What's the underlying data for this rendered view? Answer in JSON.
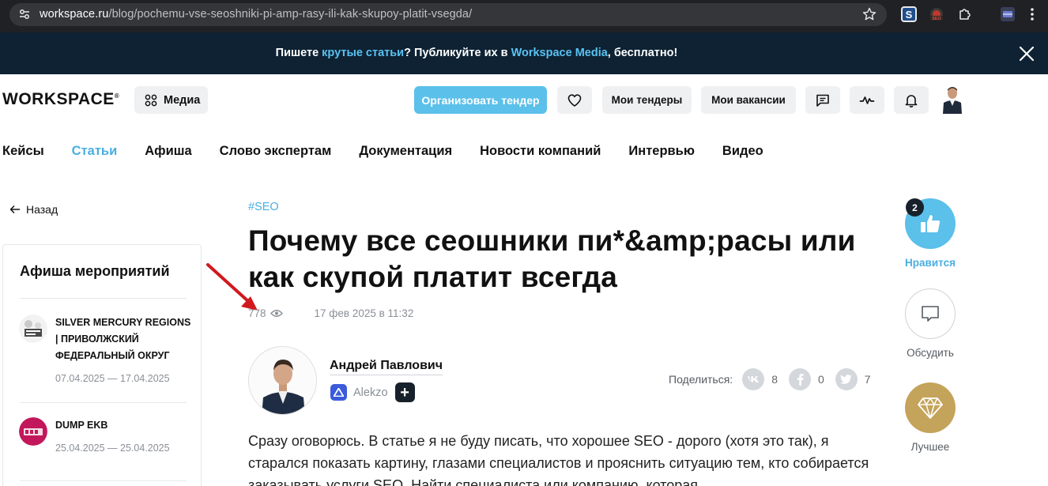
{
  "browser": {
    "url_host": "workspace.ru",
    "url_path": "/blog/pochemu-vse-seoshniki-pi-amp-rasy-ili-kak-skupoy-platit-vsegda/"
  },
  "promo": {
    "part1": "Пишете ",
    "link1": "крутые статьи",
    "part2": "? Публикуйте их в ",
    "link2": "Workspace Media",
    "part3": ", бесплатно!"
  },
  "header": {
    "logo": "WORKSPACE",
    "media_label": "Медиа",
    "tender_label": "Организовать тендер",
    "my_tenders": "Мои тендеры",
    "my_vacancies": "Мои вакансии"
  },
  "nav": [
    {
      "label": "Кейсы",
      "active": false
    },
    {
      "label": "Статьи",
      "active": true
    },
    {
      "label": "Афиша",
      "active": false
    },
    {
      "label": "Слово экспертам",
      "active": false
    },
    {
      "label": "Документация",
      "active": false
    },
    {
      "label": "Новости компаний",
      "active": false
    },
    {
      "label": "Интервью",
      "active": false
    },
    {
      "label": "Видео",
      "active": false
    }
  ],
  "back_label": "Назад",
  "events": {
    "title": "Афиша мероприятий",
    "items": [
      {
        "name": "SILVER MERCURY REGIONS | ПРИВОЛЖСКИЙ ФЕДЕРАЛЬНЫЙ ОКРУГ",
        "dates": "07.04.2025 — 17.04.2025"
      },
      {
        "name": "DUMP EKB",
        "dates": "25.04.2025 — 25.04.2025"
      }
    ]
  },
  "article": {
    "tag": "#SEO",
    "title": "Почему все сеошники пи*&amp;расы или как скупой платит всегда",
    "views": "778",
    "date": "17 фев 2025 в 11:32",
    "author": "Андрей Павлович",
    "company": "Alekzo",
    "share_label": "Поделиться:",
    "share": [
      {
        "network": "vk-icon",
        "count": "8"
      },
      {
        "network": "facebook-icon",
        "count": "0"
      },
      {
        "network": "twitter-icon",
        "count": "7"
      }
    ],
    "body": "Сразу оговорюсь. В статье я не буду писать, что хорошее SEO - дорого (хотя это так), я старался показать картину, глазами специалистов и прояснить ситуацию тем, кто собирается заказывать услуги SEO. Найти специалиста или компанию, которая"
  },
  "reactions": {
    "like_count": "2",
    "like_label": "Нравится",
    "discuss_label": "Обсудить",
    "best_label": "Лучшее"
  },
  "colors": {
    "accent": "#4aaee0",
    "tender": "#5bc0ea",
    "banner": "#0e2233",
    "gold": "#c4a35a"
  }
}
